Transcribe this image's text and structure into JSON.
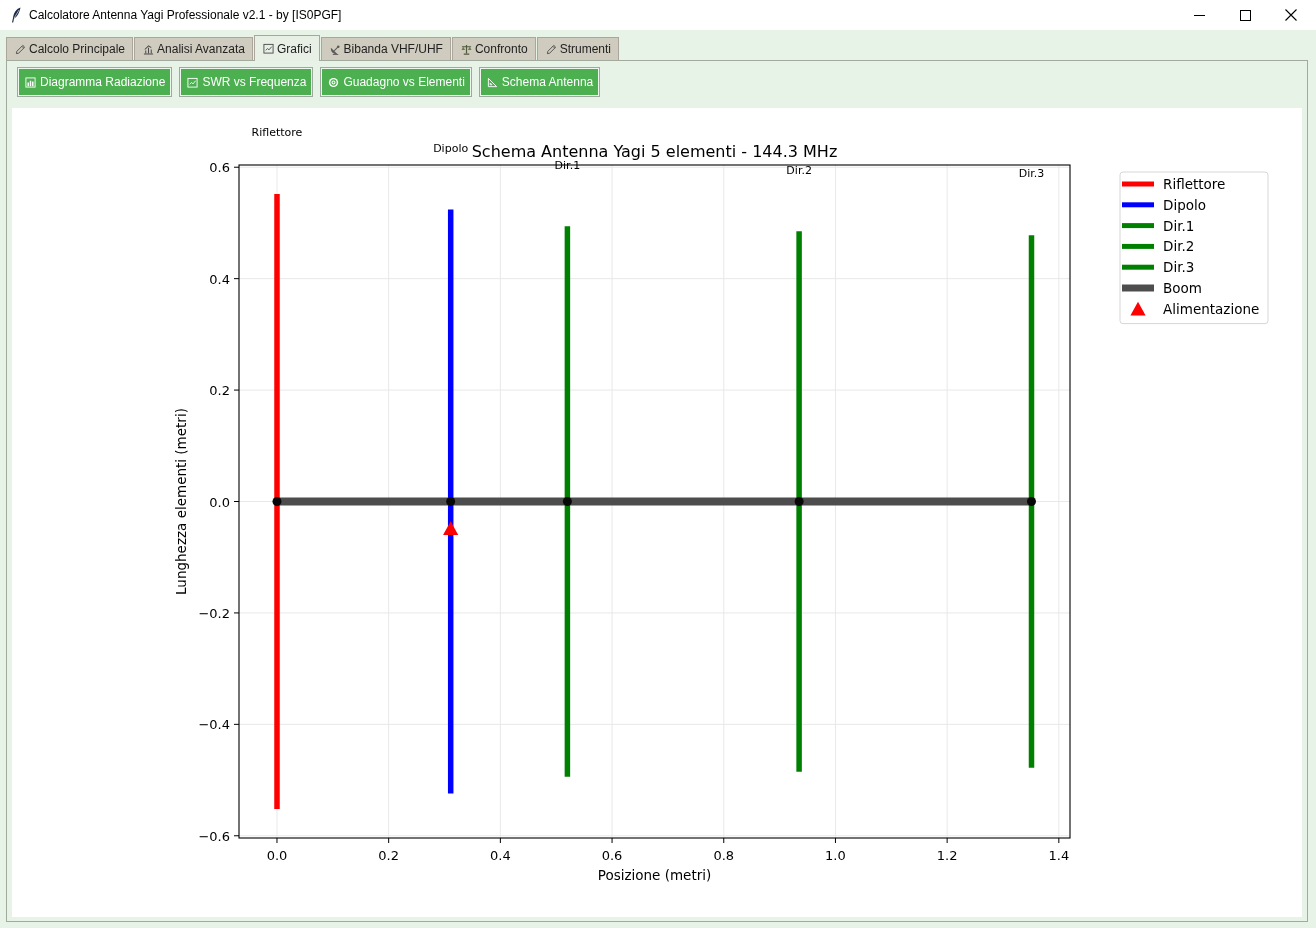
{
  "window": {
    "title": "Calcolatore Antenna Yagi Professionale v2.1 - by [IS0PGF]"
  },
  "tabs": [
    {
      "label": "Calcolo Principale",
      "selected": false
    },
    {
      "label": "Analisi Avanzata",
      "selected": false
    },
    {
      "label": "Grafici",
      "selected": true
    },
    {
      "label": "Bibanda VHF/UHF",
      "selected": false
    },
    {
      "label": "Confronto",
      "selected": false
    },
    {
      "label": "Strumenti",
      "selected": false
    }
  ],
  "toolbar": {
    "buttons": [
      {
        "label": "Diagramma Radiazione"
      },
      {
        "label": "SWR vs Frequenza"
      },
      {
        "label": "Guadagno vs Elementi"
      },
      {
        "label": "Schema Antenna"
      }
    ]
  },
  "plot": {
    "chart_data": {
      "type": "line",
      "title": "Schema Antenna Yagi 5 elementi - 144.3 MHz",
      "xlabel": "Posizione (metri)",
      "ylabel": "Lunghezza elementi (metri)",
      "series": [
        {
          "name": "Riflettore",
          "color": "#ff0000",
          "x": [
            0,
            0
          ],
          "values": [
            -0.552,
            0.552
          ]
        },
        {
          "name": "Dipolo",
          "color": "#0000ff",
          "x": [
            0.311,
            0.311
          ],
          "values": [
            -0.524,
            0.524
          ]
        },
        {
          "name": "Dir.1",
          "color": "#008000",
          "x": [
            0.52,
            0.52
          ],
          "values": [
            -0.494,
            0.494
          ]
        },
        {
          "name": "Dir.2",
          "color": "#008000",
          "x": [
            0.935,
            0.935
          ],
          "values": [
            -0.485,
            0.485
          ]
        },
        {
          "name": "Dir.3",
          "color": "#008000",
          "x": [
            1.351,
            1.351
          ],
          "values": [
            -0.478,
            0.478
          ]
        },
        {
          "name": "Boom",
          "color": "#4d4d4d",
          "marker": "o",
          "x": [
            0,
            0.311,
            0.52,
            0.935,
            1.351
          ],
          "values": [
            0,
            0,
            0,
            0,
            0
          ]
        },
        {
          "name": "Alimentazione",
          "color": "#ff0000",
          "marker": "^",
          "x": [
            0.311
          ],
          "values": [
            -0.05
          ]
        }
      ],
      "xlim": [
        -0.068,
        1.42
      ],
      "ylim": [
        -0.604,
        0.604
      ],
      "xticks": [
        {
          "value": 0,
          "label": "0.0"
        },
        {
          "value": 0.2,
          "label": "0.2"
        },
        {
          "value": 0.4,
          "label": "0.4"
        },
        {
          "value": 0.6,
          "label": "0.6"
        },
        {
          "value": 0.8,
          "label": "0.8"
        },
        {
          "value": 1.0,
          "label": "1.0"
        },
        {
          "value": 1.2,
          "label": "1.2"
        },
        {
          "value": 1.4,
          "label": "1.4"
        }
      ],
      "yticks": [
        {
          "value": -0.6,
          "label": "−0.6"
        },
        {
          "value": -0.4,
          "label": "−0.4"
        },
        {
          "value": -0.2,
          "label": "−0.2"
        },
        {
          "value": 0,
          "label": "0.0"
        },
        {
          "value": 0.2,
          "label": "0.2"
        },
        {
          "value": 0.4,
          "label": "0.4"
        },
        {
          "value": 0.6,
          "label": "0.6"
        }
      ],
      "grid": true,
      "legend": "outside right",
      "annotations": [
        "Riflettore",
        "Dipolo",
        "Dir.1",
        "Dir.2",
        "Dir.3"
      ]
    }
  }
}
